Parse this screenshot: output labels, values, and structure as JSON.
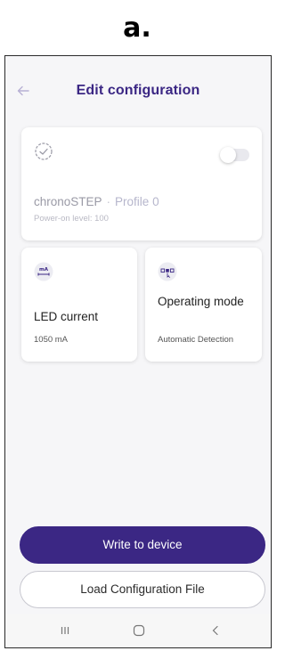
{
  "figure_label": "a.",
  "header": {
    "title": "Edit configuration"
  },
  "profile_card": {
    "name": "chronoSTEP",
    "separator": "·",
    "profile": "Profile 0",
    "power_on": "Power-on level: 100",
    "toggle_on": false
  },
  "led_card": {
    "icon_text": "mA",
    "label": "LED current",
    "value": "1050 mA"
  },
  "mode_card": {
    "label": "Operating mode",
    "value": "Automatic Detection"
  },
  "buttons": {
    "write": "Write to device",
    "load": "Load Configuration File"
  },
  "colors": {
    "accent": "#3b2784",
    "background": "#f6f6f8"
  },
  "icons": {
    "back": "arrow-left-icon",
    "profile": "clock-check-icon",
    "led": "current-ma-icon",
    "mode": "operating-mode-icon",
    "recents": "recents-icon",
    "home": "home-icon",
    "nav_back": "chevron-left-icon"
  }
}
